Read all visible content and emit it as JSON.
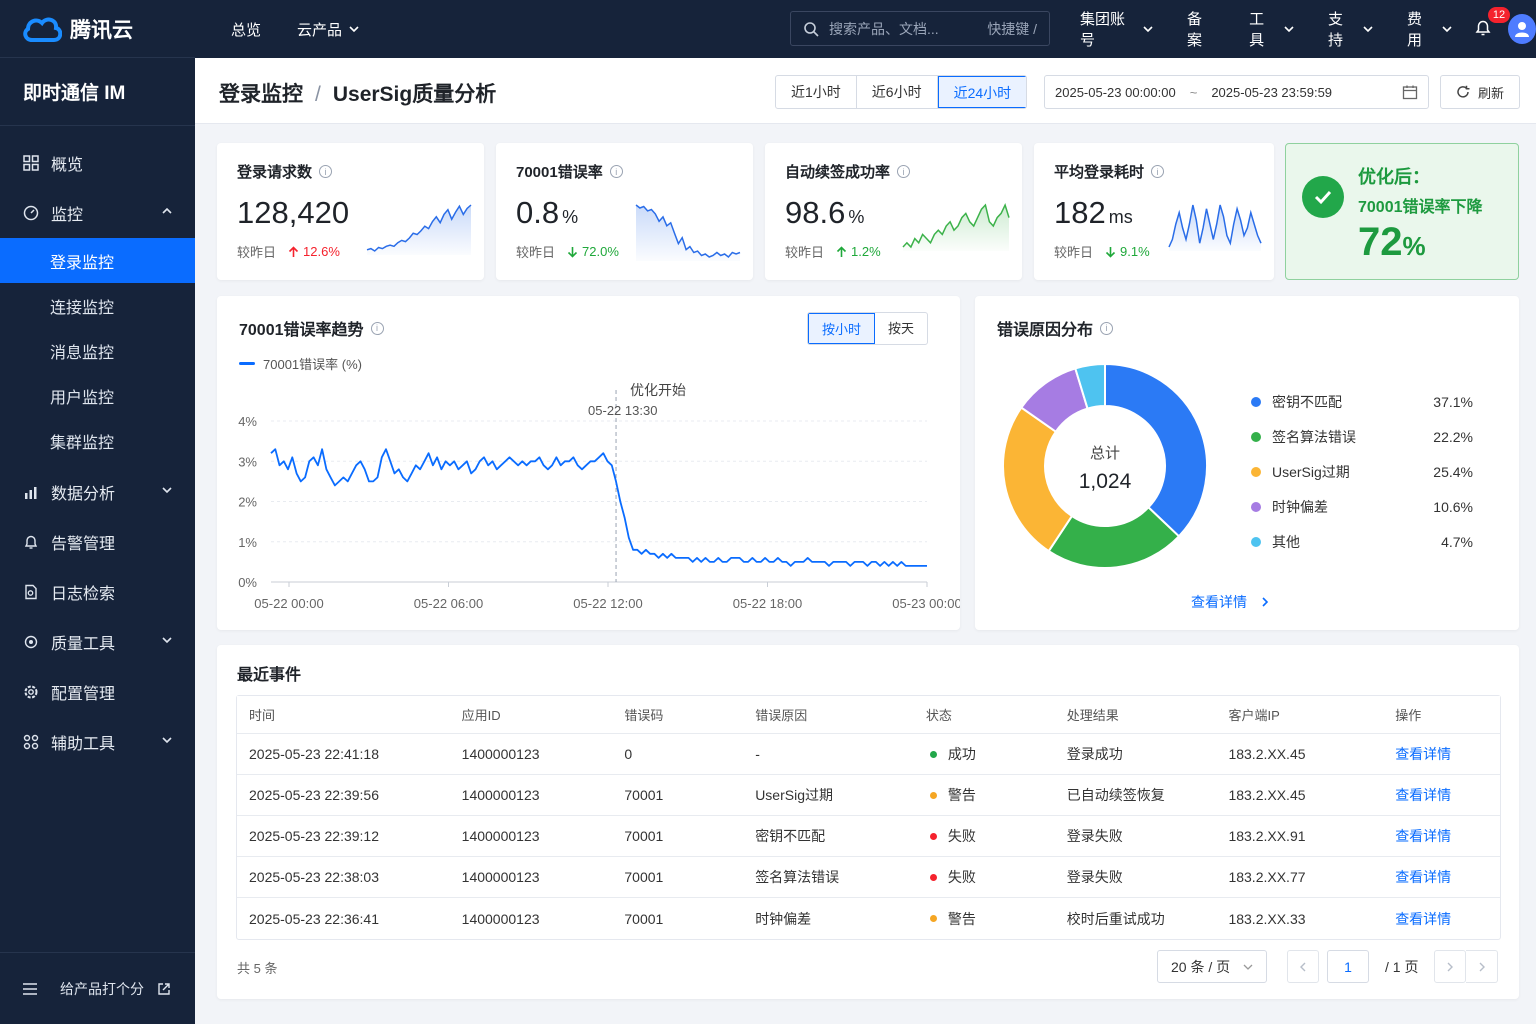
{
  "brand": {
    "name": "腾讯云"
  },
  "product": {
    "name": "即时通信 IM"
  },
  "topnav": {
    "overview": "总览",
    "products": "云产品",
    "search_placeholder": "搜索产品、文档...",
    "shortcut": "快捷键 /",
    "account": "集团账号",
    "filing": "备案",
    "tools": "工具",
    "support": "支持",
    "billing": "费用",
    "notifications": "12"
  },
  "sidebar": {
    "overview": "概览",
    "monitor": "监控",
    "sub": [
      "登录监控",
      "连接监控",
      "消息监控",
      "用户监控",
      "集群监控"
    ],
    "data_analysis": "数据分析",
    "alarm": "告警管理",
    "logs": "日志检索",
    "quality": "质量工具",
    "config": "配置管理",
    "aux": "辅助工具",
    "feedback": "给产品打个分"
  },
  "header": {
    "crumb1": "登录监控",
    "sep": "/",
    "crumb2": "UserSig质量分析",
    "t1": "近1小时",
    "t6": "近6小时",
    "t24": "近24小时",
    "start": "2025-05-23 00:00:00",
    "tilde": "~",
    "end": "2025-05-23 23:59:59",
    "refresh": "刷新"
  },
  "kpis": [
    {
      "title": "登录请求数",
      "value": "128,420",
      "unit": "",
      "cmp": "较昨日",
      "delta": "12.6%",
      "dir": "up",
      "color": "#2a6de8",
      "spark": [
        10,
        11,
        9,
        12,
        11,
        13,
        14,
        13,
        16,
        18,
        17,
        20,
        24,
        23,
        26,
        30,
        28,
        34,
        38,
        33,
        40,
        44,
        36,
        42,
        47,
        40,
        45,
        48
      ]
    },
    {
      "title": "70001错误率",
      "value": "0.8",
      "unit": "%",
      "cmp": "较昨日",
      "delta": "72.0%",
      "dir": "down",
      "color": "#2a6de8",
      "spark": [
        44,
        42,
        43,
        40,
        41,
        38,
        33,
        36,
        30,
        32,
        25,
        18,
        22,
        14,
        16,
        12,
        13,
        10,
        11,
        9,
        10,
        12,
        10,
        11,
        9,
        12,
        11,
        12
      ]
    },
    {
      "title": "自动续签成功率",
      "value": "98.6",
      "unit": "%",
      "cmp": "较昨日",
      "delta": "1.2%",
      "dir": "up",
      "color": "#3cb24a",
      "spark": [
        30,
        31,
        30,
        32,
        31,
        33,
        32,
        31,
        33,
        34,
        33,
        35,
        36,
        34,
        35,
        37,
        38,
        36,
        35,
        37,
        39,
        40,
        36,
        35,
        37,
        38,
        40,
        37
      ]
    },
    {
      "title": "平均登录耗时",
      "value": "182",
      "unit": "ms",
      "cmp": "较昨日",
      "delta": "9.1%",
      "dir": "down",
      "color": "#2a6de8",
      "spark": [
        18,
        22,
        30,
        36,
        28,
        22,
        30,
        40,
        32,
        20,
        28,
        38,
        30,
        22,
        30,
        40,
        34,
        24,
        20,
        30,
        38,
        32,
        24,
        28,
        36,
        30,
        24,
        20
      ]
    }
  ],
  "optimized": {
    "line1": "优化后：",
    "line2": "70001错误率下降",
    "value": "72",
    "unit": "%"
  },
  "trend": {
    "title": "70001错误率趋势",
    "by_hour": "按小时",
    "by_day": "按天",
    "legend": "70001错误率 (%)",
    "marker_line1": "优化开始",
    "marker_line2": "05-22 13:30"
  },
  "chart_data": [
    {
      "type": "line",
      "title": "70001错误率趋势",
      "x": [
        "05-22 00:00",
        "05-22 06:00",
        "05-22 12:00",
        "05-22 18:00",
        "05-23 00:00"
      ],
      "yticks": [
        "0%",
        "1%",
        "2%",
        "3%",
        "4%"
      ],
      "ylim": [
        0,
        4.2
      ],
      "series": [
        {
          "name": "70001错误率 (%)",
          "values": [
            3.2,
            3.3,
            2.9,
            3.0,
            2.8,
            3.1,
            2.7,
            2.5,
            2.6,
            3.0,
            3.1,
            2.9,
            3.3,
            2.8,
            2.6,
            2.4,
            2.5,
            2.6,
            2.5,
            2.7,
            2.9,
            3.0,
            2.8,
            2.5,
            2.5,
            2.6,
            3.1,
            3.3,
            3.0,
            2.7,
            2.8,
            2.6,
            2.5,
            2.7,
            2.9,
            2.8,
            3.0,
            3.2,
            2.9,
            3.1,
            2.8,
            3.0,
            2.9,
            3.0,
            2.8,
            2.9,
            3.0,
            2.7,
            2.8,
            3.0,
            3.1,
            2.9,
            3.0,
            2.8,
            2.9,
            3.0,
            3.1,
            3.0,
            2.9,
            3.0,
            2.9,
            3.0,
            3.0,
            3.1,
            2.9,
            2.8,
            2.9,
            3.1,
            2.9,
            3.0,
            3.0,
            3.1,
            2.9,
            2.8,
            2.9,
            3.0,
            3.0,
            3.1,
            3.2,
            3.0,
            2.9,
            2.5,
            2.0,
            1.6,
            1.1,
            0.8,
            0.8,
            0.7,
            0.8,
            0.7,
            0.7,
            0.6,
            0.7,
            0.6,
            0.7,
            0.6,
            0.6,
            0.6,
            0.6,
            0.5,
            0.6,
            0.5,
            0.6,
            0.5,
            0.5,
            0.6,
            0.5,
            0.5,
            0.6,
            0.6,
            0.6,
            0.5,
            0.5,
            0.6,
            0.5,
            0.5,
            0.6,
            0.5,
            0.5,
            0.6,
            0.5,
            0.5,
            0.4,
            0.5,
            0.5,
            0.5,
            0.6,
            0.5,
            0.5,
            0.5,
            0.5,
            0.4,
            0.5,
            0.5,
            0.5,
            0.5,
            0.4,
            0.5,
            0.5,
            0.5,
            0.4,
            0.5,
            0.5,
            0.4,
            0.5,
            0.4,
            0.5,
            0.4,
            0.5,
            0.4,
            0.4,
            0.4,
            0.4,
            0.4,
            0.4
          ]
        }
      ],
      "marker": {
        "x_index": 81,
        "label": "优化开始"
      }
    },
    {
      "type": "pie",
      "title": "错误原因分布",
      "center_label": "总计",
      "center_value": "1,024",
      "slices": [
        {
          "name": "密钥不匹配",
          "pct": "37.1%",
          "value": 37.1,
          "color": "#2b7af5"
        },
        {
          "name": "签名算法错误",
          "pct": "22.2%",
          "value": 22.2,
          "color": "#34b04a"
        },
        {
          "name": "UserSig过期",
          "pct": "25.4%",
          "value": 25.4,
          "color": "#fbb535"
        },
        {
          "name": "时钟偏差",
          "pct": "10.6%",
          "value": 10.6,
          "color": "#a67ce3"
        },
        {
          "name": "其他",
          "pct": "4.7%",
          "value": 4.7,
          "color": "#4ec3f0"
        }
      ]
    }
  ],
  "pie": {
    "title": "错误原因分布",
    "more": "查看详情"
  },
  "events": {
    "title": "最近事件",
    "columns": [
      "时间",
      "应用ID",
      "错误码",
      "错误原因",
      "状态",
      "处理结果",
      "客户端IP",
      "操作"
    ],
    "rows": [
      {
        "time": "2025-05-23 22:41:18",
        "app": "1400000123",
        "code": "0",
        "reason": "-",
        "status": "成功",
        "scolor": "#22a74a",
        "result": "登录成功",
        "ip": "183.2.XX.45",
        "op": "查看详情"
      },
      {
        "time": "2025-05-23 22:39:56",
        "app": "1400000123",
        "code": "70001",
        "reason": "UserSig过期",
        "status": "警告",
        "scolor": "#f5a623",
        "result": "已自动续签恢复",
        "ip": "183.2.XX.45",
        "op": "查看详情"
      },
      {
        "time": "2025-05-23 22:39:12",
        "app": "1400000123",
        "code": "70001",
        "reason": "密钥不匹配",
        "status": "失败",
        "scolor": "#f5222d",
        "result": "登录失败",
        "ip": "183.2.XX.91",
        "op": "查看详情"
      },
      {
        "time": "2025-05-23 22:38:03",
        "app": "1400000123",
        "code": "70001",
        "reason": "签名算法错误",
        "status": "失败",
        "scolor": "#f5222d",
        "result": "登录失败",
        "ip": "183.2.XX.77",
        "op": "查看详情"
      },
      {
        "time": "2025-05-23 22:36:41",
        "app": "1400000123",
        "code": "70001",
        "reason": "时钟偏差",
        "status": "警告",
        "scolor": "#f5a623",
        "result": "校时后重试成功",
        "ip": "183.2.XX.33",
        "op": "查看详情"
      }
    ],
    "total": "共 5 条",
    "page_size": "20 条 / 页",
    "page": "1",
    "pages": "/ 1 页"
  }
}
